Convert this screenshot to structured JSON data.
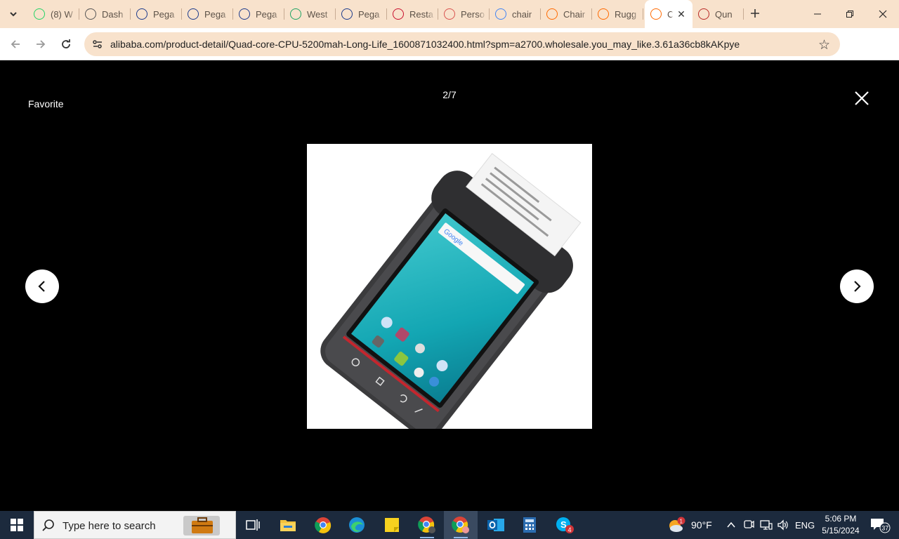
{
  "browser": {
    "tabs": [
      {
        "title": "(8) W",
        "icon": "whatsapp-icon",
        "color": "#25d366"
      },
      {
        "title": "Dash",
        "icon": "globe-icon",
        "color": "#555555"
      },
      {
        "title": "Pega",
        "icon": "paypal-icon",
        "color": "#1d3b8c"
      },
      {
        "title": "Pega",
        "icon": "paypal-icon",
        "color": "#1d3b8c"
      },
      {
        "title": "Pega",
        "icon": "paypal-icon",
        "color": "#1d3b8c"
      },
      {
        "title": "West",
        "icon": "google-drive-icon",
        "color": "#1fa463"
      },
      {
        "title": "Pega",
        "icon": "paypal-icon",
        "color": "#1d3b8c"
      },
      {
        "title": "Resta",
        "icon": "restaurant-icon",
        "color": "#c8102e"
      },
      {
        "title": "Perso",
        "icon": "perso-icon",
        "color": "#d9534f"
      },
      {
        "title": "chair",
        "icon": "google-icon",
        "color": "#4285f4"
      },
      {
        "title": "Chair",
        "icon": "alibaba-icon",
        "color": "#ff6a00"
      },
      {
        "title": "Rugg",
        "icon": "alibaba-icon",
        "color": "#ff6a00"
      },
      {
        "title": "C",
        "icon": "alibaba-icon",
        "color": "#ff6a00",
        "active": true
      },
      {
        "title": "Qun",
        "icon": "quora-icon",
        "color": "#b92b27"
      }
    ],
    "url": "alibaba.com/product-detail/Quad-core-CPU-5200mah-Long-Life_1600871032400.html?spm=a2700.wholesale.you_may_like.3.61a36cb8kAKpye",
    "accent": "#f8e2cc"
  },
  "viewer": {
    "favorite_label": "Favorite",
    "counter": "2/7",
    "image_alt": "Android POS terminal with built-in receipt printer",
    "device_screen_search_label": "Google"
  },
  "taskbar": {
    "search_placeholder": "Type here to search",
    "weather_temp": "90°F",
    "weather_badge": "1",
    "language": "ENG",
    "time": "5:06 PM",
    "date": "5/15/2024",
    "notification_count": "37",
    "skype_badge": "4"
  }
}
